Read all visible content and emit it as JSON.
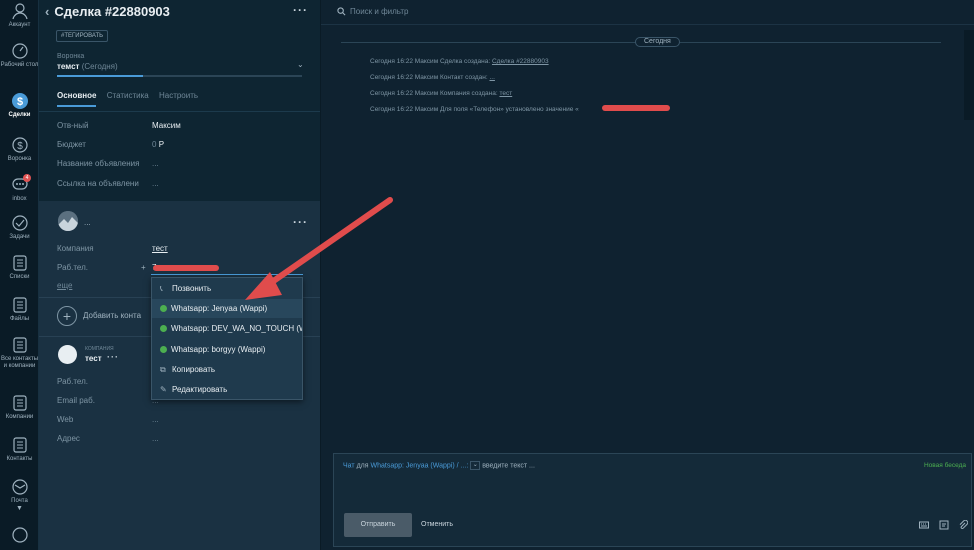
{
  "rail": {
    "items": [
      {
        "label": "Аккаунт"
      },
      {
        "label": "Рабочий стол"
      },
      {
        "label": "Сделки"
      },
      {
        "label": "Воронка"
      },
      {
        "label": "inbox",
        "badge": "4"
      },
      {
        "label": "Задачи"
      },
      {
        "label": "Списки"
      },
      {
        "label": "Файлы"
      },
      {
        "label": "Все контакты и компании"
      },
      {
        "label": "Компании"
      },
      {
        "label": "Контакты"
      },
      {
        "label": "Почта"
      }
    ]
  },
  "deal": {
    "title": "Сделка #22880903",
    "tag_button": "#ТЕГИРОВАТЬ",
    "funnel_label": "Воронка",
    "funnel_value": "темст",
    "funnel_today": "(Сегодня)",
    "progress": 0.35,
    "tabs": [
      "Основное",
      "Статистика",
      "Настроить"
    ],
    "fields": [
      {
        "label": "Отв-ный",
        "value": "Максим"
      },
      {
        "label": "Бюджет",
        "value": "0",
        "currency": "Р"
      },
      {
        "label": "Название объявления",
        "value": "..."
      },
      {
        "label": "Ссылка на объявлени",
        "value": "..."
      }
    ]
  },
  "contact": {
    "name": "...",
    "company_label": "Компания",
    "company_value": "тест",
    "phone_label": "Раб.тел.",
    "phone_value": "7",
    "more": "еще",
    "add_contact": "Добавить конта"
  },
  "company": {
    "label": "КОМПАНИЯ",
    "name": "тест",
    "fields": [
      {
        "label": "Раб.тел.",
        "value": ""
      },
      {
        "label": "Email раб.",
        "value": "..."
      },
      {
        "label": "Web",
        "value": "..."
      },
      {
        "label": "Адрес",
        "value": "..."
      }
    ]
  },
  "dropdown": {
    "items": [
      {
        "label": "Позвонить",
        "icon": "phone-icon"
      },
      {
        "label": "Whatsapp: Jenyaa (Wappi)",
        "icon": "whatsapp-icon"
      },
      {
        "label": "Whatsapp: DEV_WA_NO_TOUCH (W",
        "icon": "whatsapp-icon"
      },
      {
        "label": "Whatsapp: borgyy (Wappi)",
        "icon": "whatsapp-icon"
      },
      {
        "label": "Копировать",
        "icon": "copy-icon"
      },
      {
        "label": "Редактировать",
        "icon": "edit-icon"
      }
    ]
  },
  "feed": {
    "search_placeholder": "Поиск и фильтр",
    "date_pill": "Сегодня",
    "events": [
      {
        "text": "Сегодня 16:22 Максим Сделка создана: ",
        "link": "Сделка #22880903"
      },
      {
        "text": "Сегодня 16:22 Максим Контакт создан: ",
        "link": "..."
      },
      {
        "text": "Сегодня 16:22 Максим Компания создана: ",
        "link": "тест"
      },
      {
        "text": "Сегодня 16:22 Максим Для поля «Телефон» установлено значение «",
        "link": ""
      }
    ]
  },
  "composer": {
    "chat": "Чат",
    "for": "для",
    "channel": "Whatsapp: Jenyaa (Wappi) / ...:",
    "placeholder": "введите текст ...",
    "new_conversation": "Новая беседа",
    "send": "Отправить",
    "cancel": "Отменить"
  },
  "colors": {
    "accent": "#4a9bd8",
    "annotation_arrow": "#e04c4c",
    "whatsapp": "#4caf50"
  }
}
